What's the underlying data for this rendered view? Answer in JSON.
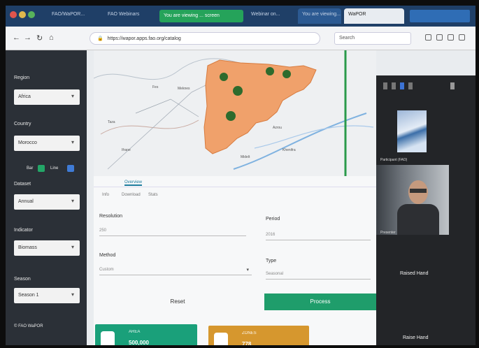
{
  "browser": {
    "tabs": [
      {
        "label": "FAO/WaPOR...",
        "active": false
      },
      {
        "label": "FAO Webinars",
        "active": false
      },
      {
        "label": "Webinar on...",
        "active": false
      },
      {
        "label": "You are viewing...",
        "active": false
      },
      {
        "label": "WaPOR",
        "active": true
      }
    ],
    "share_banner": "You are viewing ... screen",
    "address": "https://wapor.apps.fao.org/catalog",
    "search_text": "Search"
  },
  "sidebar": {
    "region_label": "Region",
    "region_value": "Africa",
    "country_label": "Country",
    "country_value": "Morocco",
    "toggle1_label": "Bar",
    "toggle2_label": "Line",
    "dataset_label": "Dataset",
    "dataset_value": "Annual",
    "indicator_label": "Indicator",
    "indicator_value": "Biomass",
    "season_label": "Season",
    "season_value": "Season 1",
    "footer": "© FAO WaPOR"
  },
  "map": {
    "labels": [
      "Fes",
      "Meknes",
      "Taza",
      "Ifrane",
      "Azrou",
      "Khenifra",
      "Midelt"
    ]
  },
  "content": {
    "active_tab": "Overview",
    "subtabs": [
      "Info",
      "Download",
      "Stats"
    ],
    "field1_label": "Resolution",
    "field1_value": "250",
    "field2_label": "Period",
    "field2_value": "2016",
    "field3_label": "Method",
    "field3_value": "Custom",
    "field4_label": "Type",
    "field4_value": "Seasonal",
    "reset_label": "Reset",
    "process_label": "Process",
    "card1_title": "AREA",
    "card1_value": "500,000",
    "card2_title": "ZONES",
    "card2_value": "778"
  },
  "video": {
    "participant1": "Participant (FAO)",
    "participant2": "Presenter",
    "option1": "Raised Hand",
    "option2": "Raise Hand"
  },
  "colors": {
    "sidebar": "#2b3037",
    "accent_green": "#1f9d6b",
    "card_green": "#1aa07a",
    "card_orange": "#d6972e",
    "region_fill": "#f0a16b",
    "tab_bar": "#1f3f67"
  }
}
